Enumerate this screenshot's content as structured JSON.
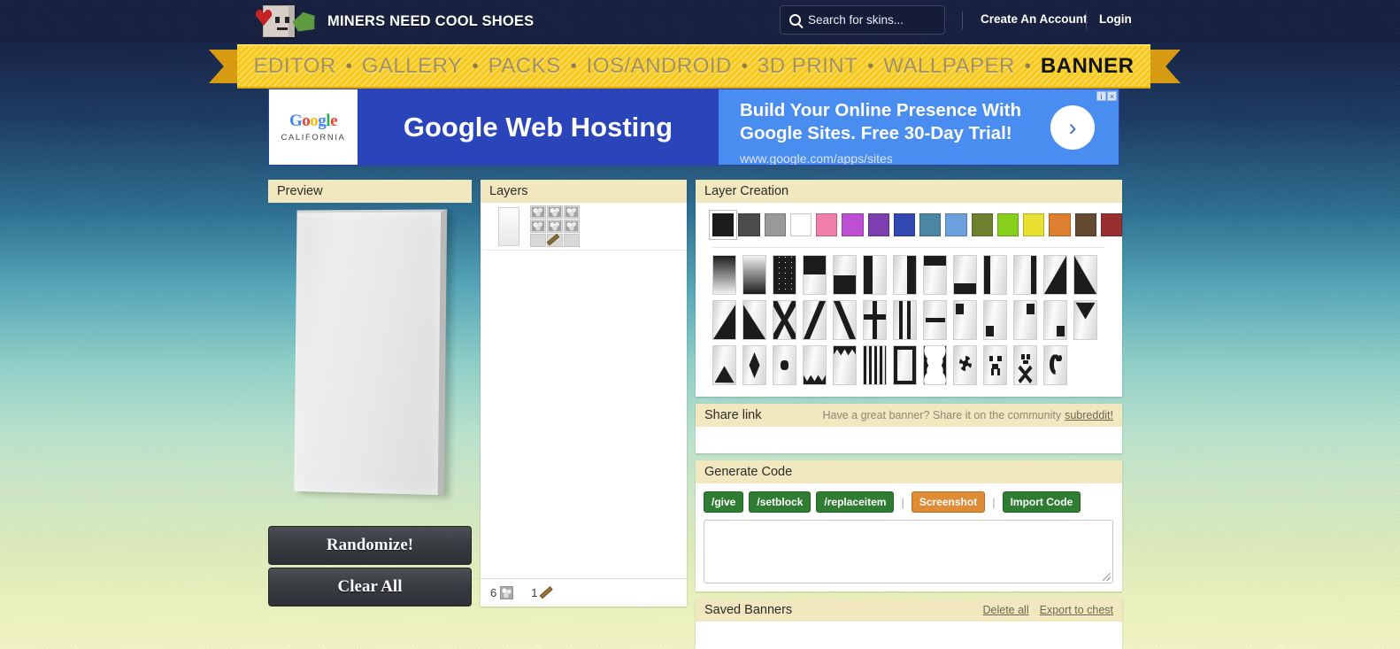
{
  "header": {
    "brand_name": "MINERS NEED COOL SHOES",
    "search": {
      "placeholder": "Search for skins...",
      "icon": "search-icon"
    },
    "create_account": "Create An Account",
    "login": "Login"
  },
  "nav": {
    "items": [
      {
        "label": "EDITOR",
        "active": false
      },
      {
        "label": "GALLERY",
        "active": false
      },
      {
        "label": "PACKS",
        "active": false
      },
      {
        "label": "IOS/ANDROID",
        "active": false
      },
      {
        "label": "3D PRINT",
        "active": false
      },
      {
        "label": "WALLPAPER",
        "active": false
      },
      {
        "label": "BANNER",
        "active": true
      }
    ],
    "separator": "•"
  },
  "ad": {
    "logo_word": "Google",
    "logo_sub": "CALIFORNIA",
    "headline": "Google Web Hosting",
    "line1": "Build Your Online Presence With",
    "line2": "Google Sites. Free 30-Day Trial!",
    "url": "www.google.com/apps/sites",
    "arrow": "›",
    "badge_info": "i",
    "badge_close": "×"
  },
  "preview": {
    "title": "Preview",
    "randomize_label": "Randomize!",
    "clear_all_label": "Clear All",
    "banner_color": "#ffffff"
  },
  "layers": {
    "title": "Layers",
    "rows": [
      {
        "name": "base-layer",
        "thumb_color": "#ffffff",
        "recipe": [
          "wool",
          "wool",
          "wool",
          "wool",
          "wool",
          "wool",
          "empty",
          "stick",
          "empty"
        ]
      }
    ],
    "cost": [
      {
        "count": "6",
        "icon": "wool-icon"
      },
      {
        "count": "1",
        "icon": "stick-icon"
      }
    ]
  },
  "creation": {
    "title": "Layer Creation",
    "selected_color_index": 0,
    "colors": [
      {
        "name": "black",
        "hex": "#1d1c1c"
      },
      {
        "name": "dark-gray",
        "hex": "#4b4b4b"
      },
      {
        "name": "gray",
        "hex": "#9a9a9a"
      },
      {
        "name": "white",
        "hex": "#ffffff"
      },
      {
        "name": "pink",
        "hex": "#ef7fa8"
      },
      {
        "name": "magenta",
        "hex": "#b council"
      },
      {
        "name": "purple",
        "hex": "#7b3fb0"
      },
      {
        "name": "blue",
        "hex": "#3149b0"
      },
      {
        "name": "cyan",
        "hex": "#4b87a3"
      },
      {
        "name": "light-blue",
        "hex": "#6ba0dd"
      },
      {
        "name": "green",
        "hex": "#6d8030"
      },
      {
        "name": "lime",
        "hex": "#86cf1a"
      },
      {
        "name": "yellow",
        "hex": "#e8e033"
      },
      {
        "name": "orange",
        "hex": "#dd8130"
      },
      {
        "name": "brown",
        "hex": "#634a31"
      },
      {
        "name": "red",
        "hex": "#983030"
      }
    ],
    "patterns": [
      [
        "gradient",
        "gradient-up",
        "bricks",
        "half-top",
        "half-bottom",
        "half-left",
        "half-right",
        "square-top-left-band",
        "stripe-center-bottom",
        "stripe-left",
        "stripe-right",
        "diagonal-right",
        "diagonal-left"
      ],
      [
        "diagonal-bottom-right",
        "diagonal-bottom-left",
        "cross",
        "stripe-downright",
        "stripe-downleft",
        "straight-cross",
        "stripe-middle",
        "stripe-center-horizontal",
        "square-top-left",
        "square-bottom-left",
        "square-top-right",
        "square-bottom-right",
        "triangle-top"
      ],
      [
        "triangle-bottom",
        "rhombus",
        "small-circle",
        "triangles-bottom",
        "triangles-top",
        "small-stripes",
        "border",
        "curly-border",
        "flower",
        "creeper",
        "skull",
        "mojang"
      ]
    ]
  },
  "share": {
    "title": "Share link",
    "note": "Have a great banner? Share it on the community",
    "link_label": "subreddit!",
    "value": ""
  },
  "generate": {
    "title": "Generate Code",
    "buttons": [
      {
        "label": "/give",
        "style": "green"
      },
      {
        "label": "/setblock",
        "style": "green"
      },
      {
        "label": "/replaceitem",
        "style": "green"
      },
      {
        "label": "Screenshot",
        "style": "orange"
      },
      {
        "label": "Import Code",
        "style": "green"
      }
    ],
    "separator": "|",
    "code_value": ""
  },
  "saved": {
    "title": "Saved Banners",
    "delete_all": "Delete all",
    "export": "Export to chest"
  }
}
